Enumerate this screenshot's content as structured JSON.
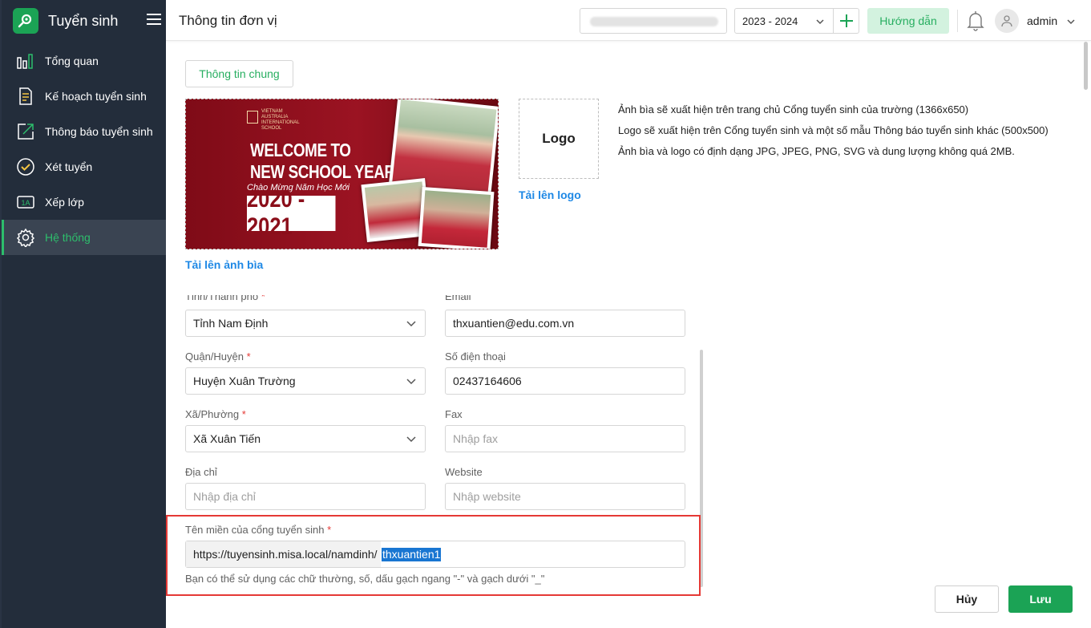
{
  "app": {
    "name": "Tuyển sinh",
    "brand_color": "#1ba355"
  },
  "sidebar": {
    "items": [
      {
        "label": "Tổng quan",
        "icon": "bar-chart-icon"
      },
      {
        "label": "Kế hoạch tuyển sinh",
        "icon": "document-list-icon"
      },
      {
        "label": "Thông báo tuyển sinh",
        "icon": "arrow-square-icon"
      },
      {
        "label": "Xét tuyển",
        "icon": "check-circle-icon"
      },
      {
        "label": "Xếp lớp",
        "icon": "class-1a-icon",
        "badge": "1A"
      },
      {
        "label": "Hệ thống",
        "icon": "gear-icon",
        "active": true
      }
    ]
  },
  "header": {
    "title": "Thông tin đơn vị",
    "year": "2023 - 2024",
    "guide_label": "Hướng dẫn",
    "user": "admin"
  },
  "tabs": {
    "general": "Thông tin chung"
  },
  "cover": {
    "school_lines": [
      "VIETNAM",
      "AUSTRALIA",
      "INTERNATIONAL",
      "SCHOOL"
    ],
    "welcome_line1": "WELCOME TO",
    "welcome_line2": "NEW SCHOOL YEAR",
    "subtitle": "Chào Mừng Năm Học Mới",
    "year": "2020 - 2021",
    "upload_label": "Tải lên ảnh bìa"
  },
  "logo": {
    "placeholder": "Logo",
    "upload_label": "Tải lên logo"
  },
  "notes": [
    "Ảnh bìa sẽ xuất hiện trên trang chủ Cổng tuyển sinh của trường (1366x650)",
    "Logo sẽ xuất hiện trên Cổng tuyển sinh và một số mẫu Thông báo tuyển sinh khác (500x500)",
    "Ảnh bìa và logo có định dạng JPG, JPEG, PNG, SVG và dung lượng không quá 2MB."
  ],
  "form": {
    "province": {
      "label": "Tỉnh/Thành phố",
      "value": "Tỉnh Nam Định"
    },
    "email": {
      "label": "Email",
      "value": "thxuantien@edu.com.vn"
    },
    "district": {
      "label": "Quận/Huyện",
      "value": "Huyện Xuân Trường"
    },
    "phone": {
      "label": "Số điện thoại",
      "value": "02437164606"
    },
    "ward": {
      "label": "Xã/Phường",
      "value": "Xã Xuân Tiến"
    },
    "fax": {
      "label": "Fax",
      "placeholder": "Nhập fax"
    },
    "address": {
      "label": "Địa chỉ",
      "placeholder": "Nhập địa chỉ"
    },
    "website": {
      "label": "Website",
      "placeholder": "Nhập website"
    },
    "domain": {
      "label": "Tên miền của cổng tuyển sinh",
      "prefix": "https://tuyensinh.misa.local/namdinh/",
      "value": "thxuantien1",
      "hint": "Bạn có thể sử dụng các chữ thường, số, dấu gạch ngang \"-\" và gạch dưới \"_\""
    },
    "required_mark": "*"
  },
  "actions": {
    "cancel": "Hủy",
    "save": "Lưu"
  }
}
